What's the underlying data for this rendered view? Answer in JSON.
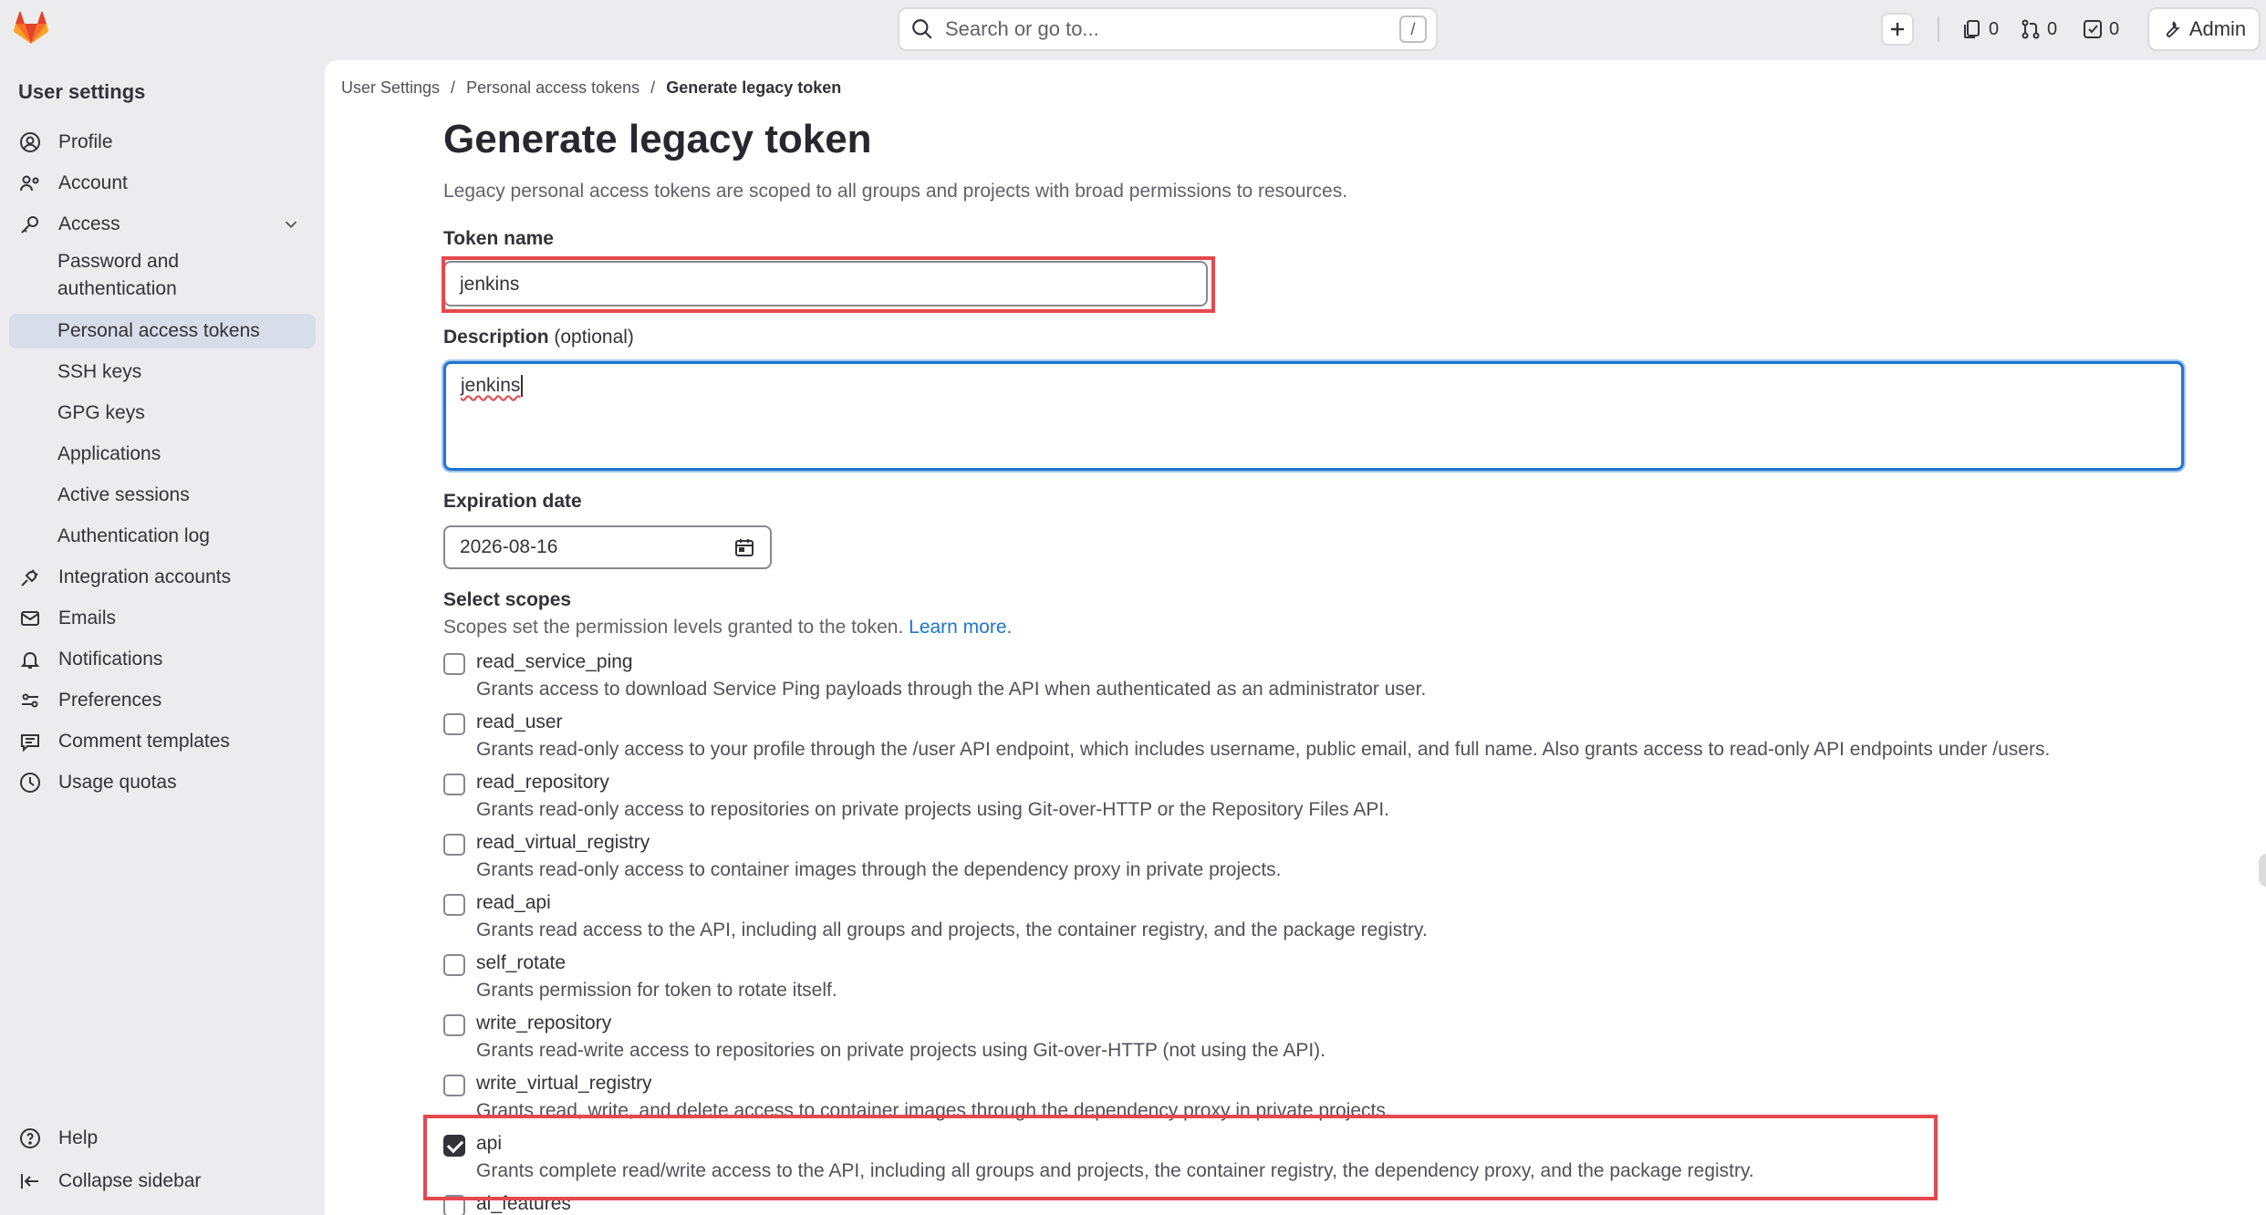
{
  "topbar": {
    "search_placeholder": "Search or go to...",
    "search_shortcut": "/",
    "issues_count": "0",
    "merge_requests_count": "0",
    "todos_count": "0",
    "admin_label": "Admin"
  },
  "sidebar": {
    "title": "User settings",
    "profile": "Profile",
    "account": "Account",
    "access": "Access",
    "password_auth": "Password and authentication",
    "personal_tokens": "Personal access tokens",
    "ssh_keys": "SSH keys",
    "gpg_keys": "GPG keys",
    "applications": "Applications",
    "active_sessions": "Active sessions",
    "auth_log": "Authentication log",
    "integration_accounts": "Integration accounts",
    "emails": "Emails",
    "notifications": "Notifications",
    "preferences": "Preferences",
    "comment_templates": "Comment templates",
    "usage_quotas": "Usage quotas",
    "help": "Help",
    "collapse": "Collapse sidebar"
  },
  "breadcrumb": {
    "item1": "User Settings",
    "item2": "Personal access tokens",
    "current": "Generate legacy token",
    "separator": "/"
  },
  "form": {
    "title": "Generate legacy token",
    "description": "Legacy personal access tokens are scoped to all groups and projects with broad permissions to resources.",
    "token_name_label": "Token name",
    "token_name_value": "jenkins",
    "description_label": "Description",
    "description_optional": "(optional)",
    "description_value": "jenkins",
    "expiration_label": "Expiration date",
    "expiration_value": "2026-08-16",
    "scopes_label": "Select scopes",
    "scopes_desc": "Scopes set the permission levels granted to the token.",
    "learn_more": "Learn more."
  },
  "scopes": [
    {
      "name": "read_service_ping",
      "desc": "Grants access to download Service Ping payloads through the API when authenticated as an administrator user.",
      "checked": false
    },
    {
      "name": "read_user",
      "desc": "Grants read-only access to your profile through the /user API endpoint, which includes username, public email, and full name. Also grants access to read-only API endpoints under /users.",
      "checked": false
    },
    {
      "name": "read_repository",
      "desc": "Grants read-only access to repositories on private projects using Git-over-HTTP or the Repository Files API.",
      "checked": false
    },
    {
      "name": "read_virtual_registry",
      "desc": "Grants read-only access to container images through the dependency proxy in private projects.",
      "checked": false
    },
    {
      "name": "read_api",
      "desc": "Grants read access to the API, including all groups and projects, the container registry, and the package registry.",
      "checked": false
    },
    {
      "name": "self_rotate",
      "desc": "Grants permission for token to rotate itself.",
      "checked": false
    },
    {
      "name": "write_repository",
      "desc": "Grants read-write access to repositories on private projects using Git-over-HTTP (not using the API).",
      "checked": false
    },
    {
      "name": "write_virtual_registry",
      "desc": "Grants read, write, and delete access to container images through the dependency proxy in private projects.",
      "checked": false
    },
    {
      "name": "api",
      "desc": "Grants complete read/write access to the API, including all groups and projects, the container registry, the dependency proxy, and the package registry.",
      "checked": true
    },
    {
      "name": "ai_features",
      "desc": "",
      "checked": false
    }
  ],
  "colors": {
    "highlight": "#e5484d",
    "focus_blue": "#1f75cb",
    "active_nav": "#d9dde9"
  }
}
